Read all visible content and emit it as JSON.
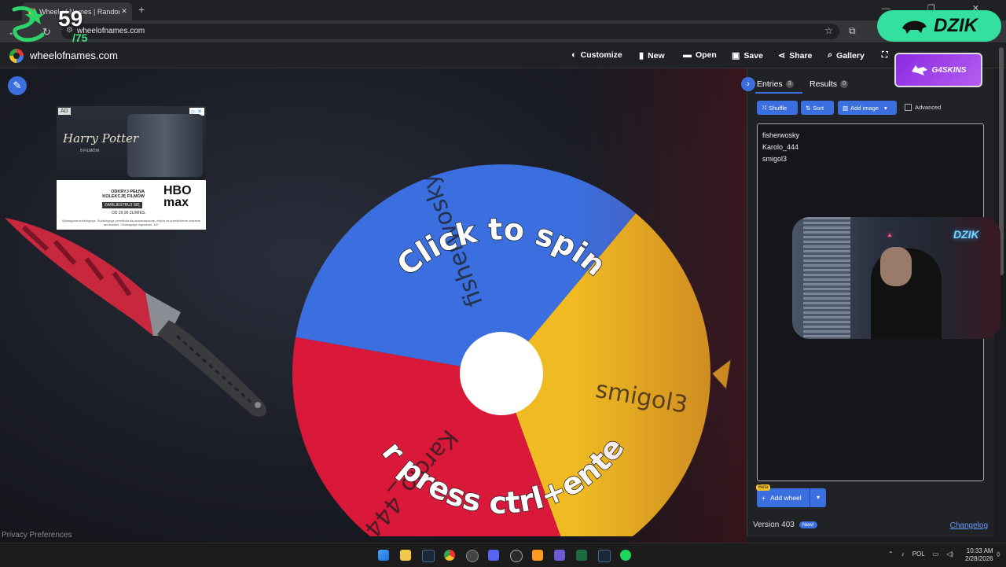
{
  "browser": {
    "tab_title": "Wheel of Names | Random nam",
    "tab_close": "✕",
    "new_tab": "+",
    "url": "wheelofnames.com",
    "window_controls": "— ❐ ✕"
  },
  "app": {
    "site_name": "wheelofnames.com",
    "menu": [
      {
        "label": "Customize",
        "icon": "palette-icon"
      },
      {
        "label": "New",
        "icon": "file-icon"
      },
      {
        "label": "Open",
        "icon": "folder-icon"
      },
      {
        "label": "Save",
        "icon": "save-icon"
      },
      {
        "label": "Share",
        "icon": "share-icon"
      },
      {
        "label": "Gallery",
        "icon": "search-icon"
      }
    ]
  },
  "ad": {
    "tag": "AD",
    "title": "Harry Potter",
    "subtitle": "8 FILMÓW",
    "cta_line1": "ODKRYJ PEŁNĄ KOLEKCJĘ FILMÓW",
    "cta_button": "ZAREJESTRUJ SIĘ",
    "price": "OD 29,99 ZŁ/MIES.",
    "brand_line1": "HBO",
    "brand_line2": "max",
    "legal": "Wymagana subskrypcja. Subskrypcja przedłuża się automatycznie, chyba że przedłużenie zostanie anulowane. Obowiązuje regulamin. 18+"
  },
  "wheel": {
    "segments": [
      {
        "name": "fisherwosky",
        "color": "#3b6fe0"
      },
      {
        "name": "smigol3",
        "color": "#f0bb22"
      },
      {
        "name": "Karolo_444",
        "color": "#d9183a"
      }
    ],
    "overlay_top": "Click to spin",
    "overlay_bottom": "or press ctrl+enter",
    "pointer_color": "#f0bb22"
  },
  "privacy_link": "Privacy Preferences",
  "panel": {
    "tab_entries": "Entries",
    "entries_count": "3",
    "tab_results": "Results",
    "results_count": "0",
    "shuffle": "Shuffle",
    "sort": "Sort",
    "add_image": "Add image",
    "advanced": "Advanced",
    "entries": [
      "fisherwosky",
      "Karolo_444",
      "smigol3"
    ],
    "beta": "Beta",
    "add_wheel": "Add wheel",
    "version": "Version 403",
    "new_badge": "New!",
    "changelog": "Changelog"
  },
  "overlay": {
    "counter_big": "59",
    "counter_small": "/75",
    "dzik_label": "DZIK",
    "g4skins_label": "G4SKINS",
    "webcam_sign": "DZIK"
  },
  "taskbar": {
    "lang": "POL",
    "time": "10:33 AM",
    "date": "2/28/2026"
  }
}
